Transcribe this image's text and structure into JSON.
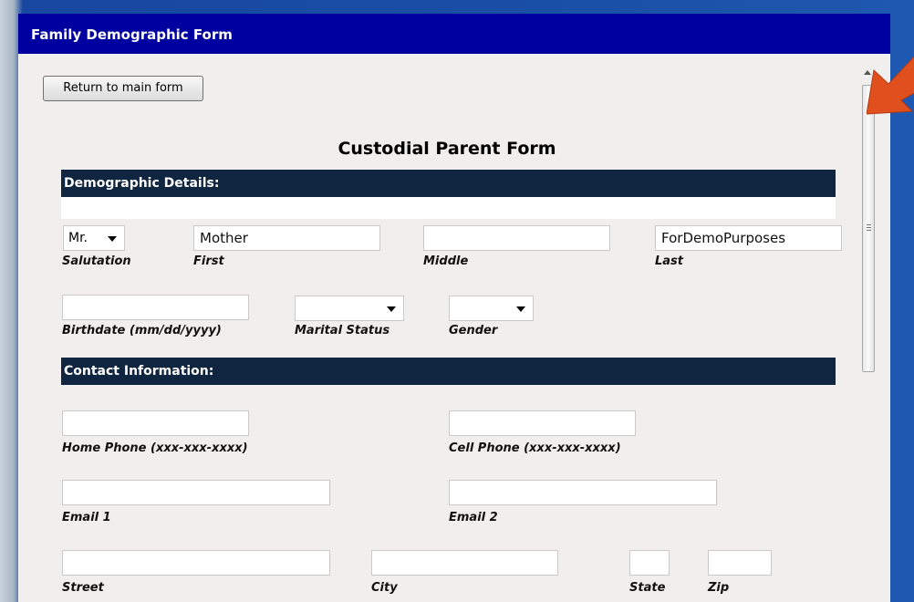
{
  "window": {
    "title": "Family Demographic Form"
  },
  "buttons": {
    "return_label": "Return to main form"
  },
  "form": {
    "title": "Custodial Parent Form",
    "sections": {
      "demographic": "Demographic Details:",
      "contact": "Contact Information:"
    },
    "fields": {
      "salutation": {
        "label": "Salutation",
        "value": "Mr."
      },
      "first": {
        "label": "First",
        "value": "Mother"
      },
      "middle": {
        "label": "Middle",
        "value": ""
      },
      "last": {
        "label": "Last",
        "value": "ForDemoPurposes"
      },
      "birthdate": {
        "label": "Birthdate (mm/dd/yyyy)",
        "value": ""
      },
      "marital_status": {
        "label": "Marital Status",
        "value": ""
      },
      "gender": {
        "label": "Gender",
        "value": ""
      },
      "home_phone": {
        "label": "Home Phone (xxx-xxx-xxxx)",
        "value": ""
      },
      "cell_phone": {
        "label": "Cell Phone (xxx-xxx-xxxx)",
        "value": ""
      },
      "email1": {
        "label": "Email 1",
        "value": ""
      },
      "email2": {
        "label": "Email 2",
        "value": ""
      },
      "street": {
        "label": "Street",
        "value": ""
      },
      "city": {
        "label": "City",
        "value": ""
      },
      "state": {
        "label": "State",
        "value": ""
      },
      "zip": {
        "label": "Zip",
        "value": ""
      }
    }
  },
  "colors": {
    "titlebar": "#0000a0",
    "section_header": "#10253f",
    "arrow": "#e0501f"
  },
  "icons": {
    "dropdown": "caret-down-icon",
    "scroll_up": "scroll-up-arrow-icon",
    "annotation": "red-pointer-arrow-icon"
  }
}
